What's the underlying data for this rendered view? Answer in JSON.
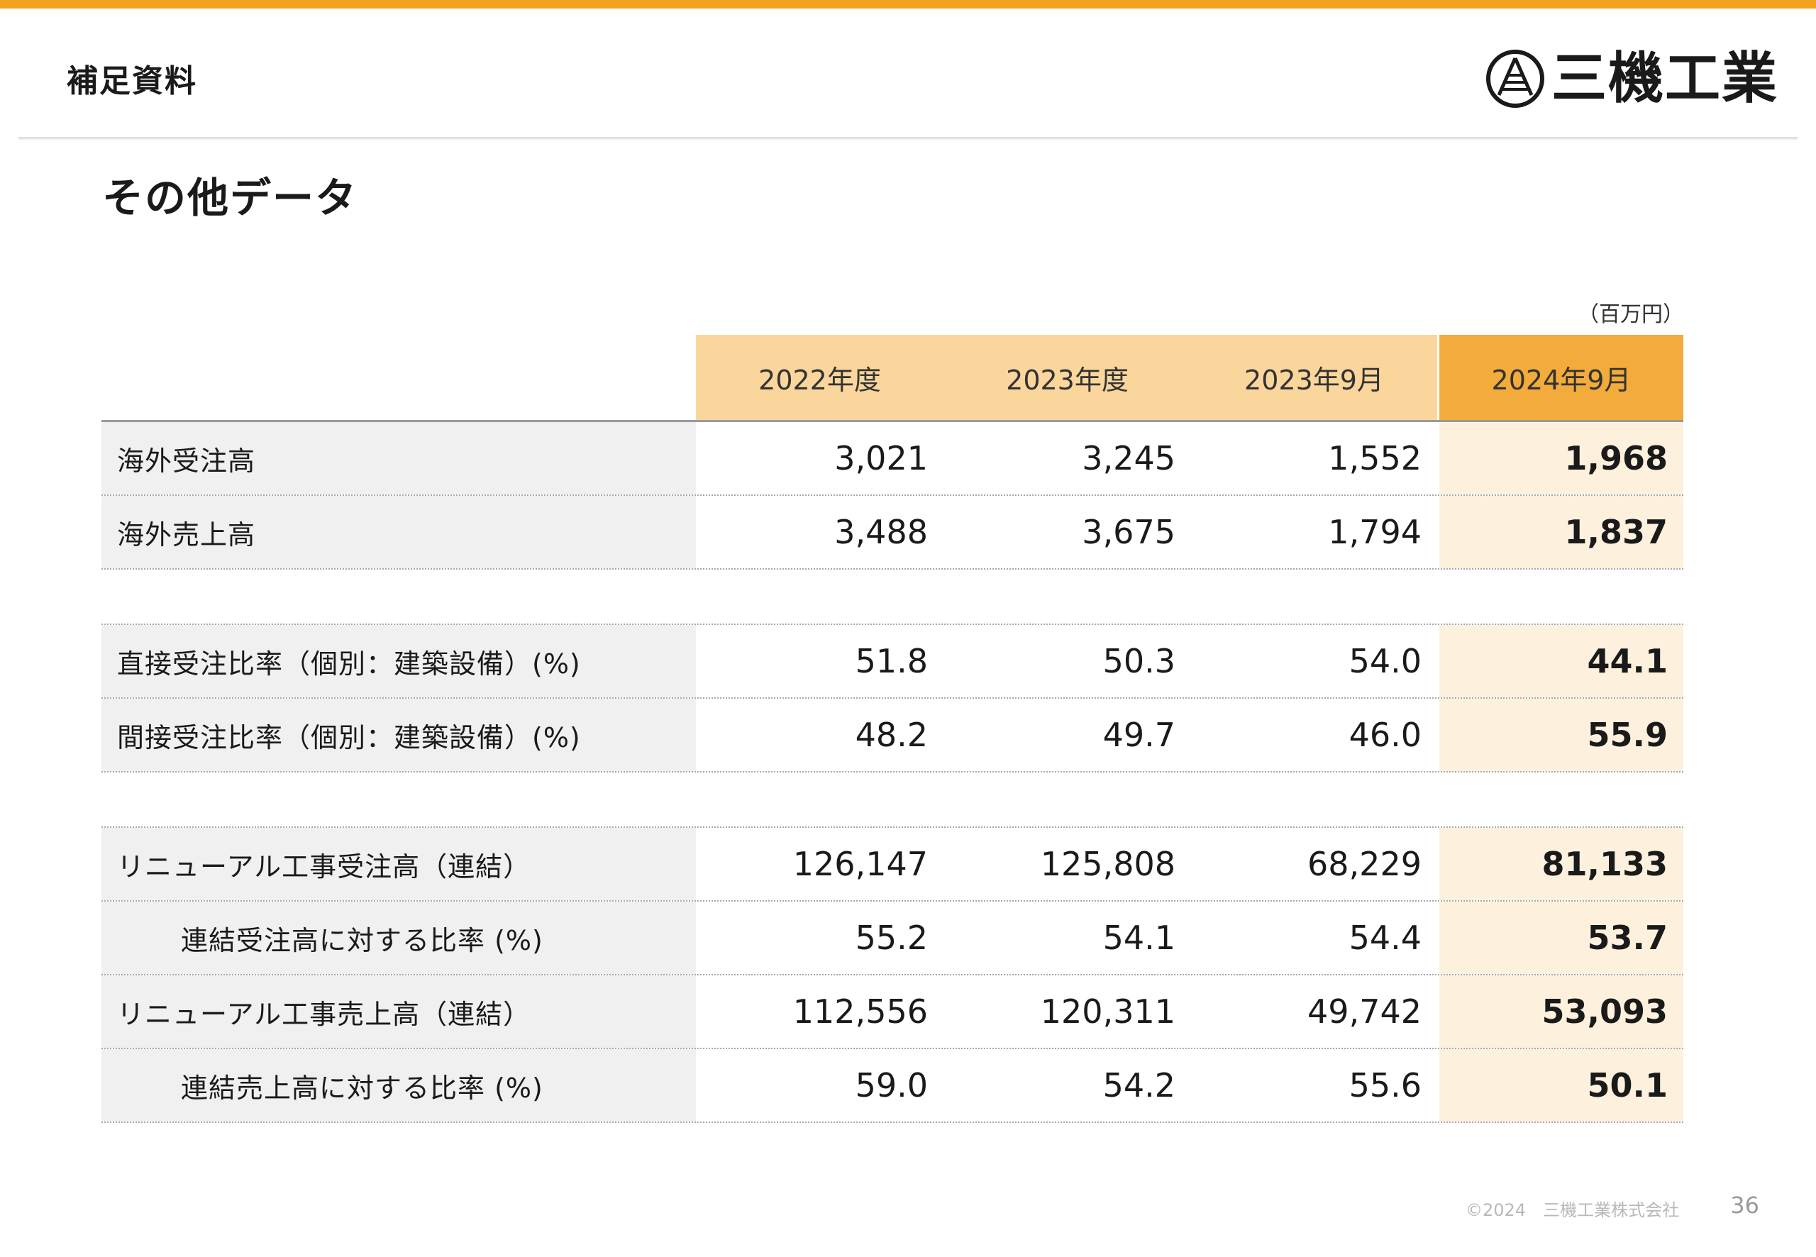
{
  "header": {
    "section_label": "補足資料"
  },
  "logo": {
    "text": "三機工業",
    "icon": "sanki-logo-icon"
  },
  "page": {
    "title": "その他データ",
    "unit_note": "（百万円）"
  },
  "table": {
    "columns": [
      "2022年度",
      "2023年度",
      "2023年9月",
      "2024年9月"
    ],
    "highlight_column": 3,
    "rows": [
      {
        "label": "海外受注高",
        "values": [
          "3,021",
          "3,245",
          "1,552",
          "1,968"
        ]
      },
      {
        "label": "海外売上高",
        "values": [
          "3,488",
          "3,675",
          "1,794",
          "1,837"
        ]
      },
      {
        "label": "直接受注比率（個別：建築設備）(%)",
        "values": [
          "51.8",
          "50.3",
          "54.0",
          "44.1"
        ]
      },
      {
        "label": "間接受注比率（個別：建築設備）(%)",
        "values": [
          "48.2",
          "49.7",
          "46.0",
          "55.9"
        ]
      },
      {
        "label": "リニューアル工事受注高（連結）",
        "values": [
          "126,147",
          "125,808",
          "68,229",
          "81,133"
        ]
      },
      {
        "label": "連結受注高に対する比率 (%)",
        "values": [
          "55.2",
          "54.1",
          "54.4",
          "53.7"
        ]
      },
      {
        "label": "リニューアル工事売上高（連結）",
        "values": [
          "112,556",
          "120,311",
          "49,742",
          "53,093"
        ]
      },
      {
        "label": "連結売上高に対する比率 (%)",
        "values": [
          "59.0",
          "54.2",
          "55.6",
          "50.1"
        ]
      }
    ]
  },
  "footer": {
    "copyright": "©2024　三機工業株式会社",
    "page_number": "36"
  },
  "colors": {
    "accent": "#f2a01e",
    "header_cell": "#fad69c",
    "header_highlight": "#f3ab3b",
    "highlight_cell": "#fdf1dd",
    "label_bg": "#f0f0f0"
  }
}
